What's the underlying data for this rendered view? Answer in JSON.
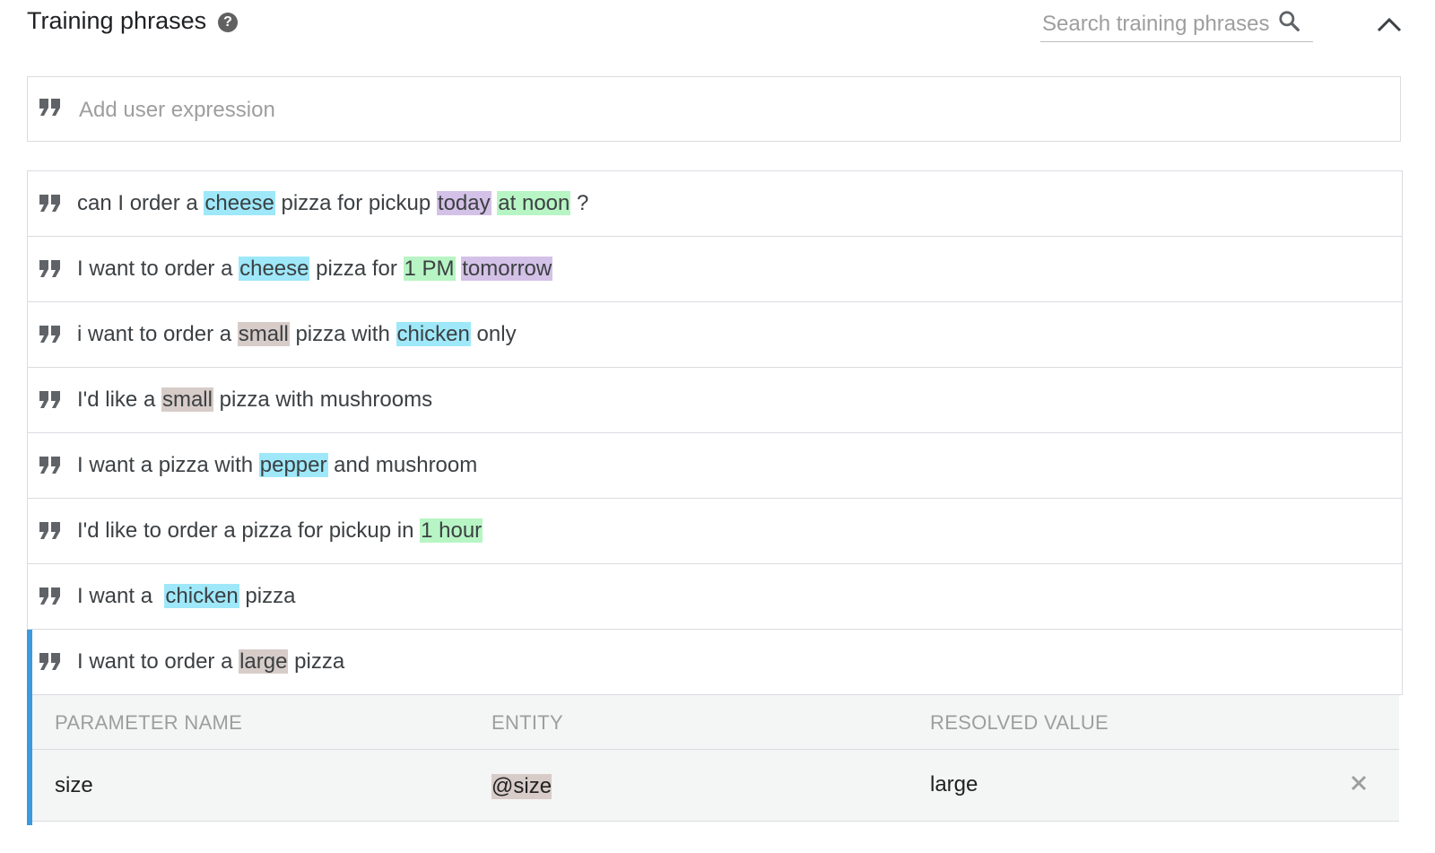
{
  "header": {
    "title": "Training phrases",
    "search_placeholder": "Search training phrases"
  },
  "add": {
    "placeholder": "Add user expression"
  },
  "phrases": [
    {
      "segments": [
        {
          "text": "can I order a ",
          "hl": ""
        },
        {
          "text": "cheese",
          "hl": "blue"
        },
        {
          "text": " pizza for pickup ",
          "hl": ""
        },
        {
          "text": "today",
          "hl": "purple"
        },
        {
          "text": " ",
          "hl": ""
        },
        {
          "text": "at noon",
          "hl": "green"
        },
        {
          "text": " ?",
          "hl": ""
        }
      ]
    },
    {
      "segments": [
        {
          "text": "I want to order a ",
          "hl": ""
        },
        {
          "text": "cheese",
          "hl": "blue"
        },
        {
          "text": " pizza for ",
          "hl": ""
        },
        {
          "text": "1 PM",
          "hl": "green"
        },
        {
          "text": " ",
          "hl": ""
        },
        {
          "text": "tomorrow",
          "hl": "purple"
        }
      ]
    },
    {
      "segments": [
        {
          "text": "i want to order a ",
          "hl": ""
        },
        {
          "text": "small",
          "hl": "brown"
        },
        {
          "text": " pizza with ",
          "hl": ""
        },
        {
          "text": "chicken",
          "hl": "blue"
        },
        {
          "text": " only",
          "hl": ""
        }
      ]
    },
    {
      "segments": [
        {
          "text": "I'd like a ",
          "hl": ""
        },
        {
          "text": "small",
          "hl": "brown"
        },
        {
          "text": " pizza with mushrooms",
          "hl": ""
        }
      ]
    },
    {
      "segments": [
        {
          "text": "I want a pizza with ",
          "hl": ""
        },
        {
          "text": "pepper",
          "hl": "blue"
        },
        {
          "text": " and mushroom",
          "hl": ""
        }
      ]
    },
    {
      "segments": [
        {
          "text": "I'd like to order a pizza for pickup in ",
          "hl": ""
        },
        {
          "text": "1 hour",
          "hl": "green"
        }
      ]
    },
    {
      "segments": [
        {
          "text": "I want a  ",
          "hl": ""
        },
        {
          "text": "chicken",
          "hl": "blue"
        },
        {
          "text": " pizza",
          "hl": ""
        }
      ]
    },
    {
      "segments": [
        {
          "text": "I want to order a ",
          "hl": ""
        },
        {
          "text": "large",
          "hl": "brown"
        },
        {
          "text": " pizza",
          "hl": ""
        }
      ]
    }
  ],
  "parameters": {
    "headers": {
      "name": "PARAMETER NAME",
      "entity": "ENTITY",
      "value": "RESOLVED VALUE"
    },
    "rows": [
      {
        "name": "size",
        "entity": "@size",
        "value": "large"
      }
    ]
  },
  "colors": {
    "blue": "#9ee8f9",
    "purple": "#d4c1e7",
    "green": "#b8f5c4",
    "brown": "#d7ccc8",
    "selected": "#3b99e0"
  }
}
